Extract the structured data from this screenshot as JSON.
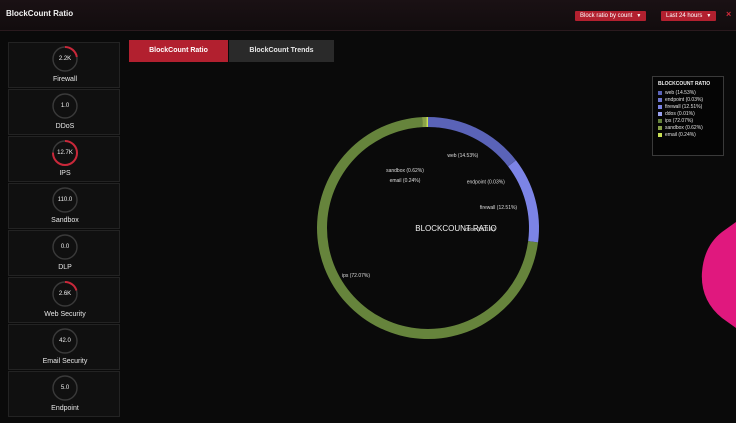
{
  "header": {
    "title": "BlockCount Ratio",
    "dropdown_ratio": "Block ratio by count",
    "dropdown_time": "Last 24 hours",
    "close_symbol": "×"
  },
  "sidebar": {
    "tiles": [
      {
        "value": "2.2K",
        "label": "Firewall",
        "gauge": 0.22
      },
      {
        "value": "1.0",
        "label": "DDoS",
        "gauge": 0.0
      },
      {
        "value": "12.7K",
        "label": "IPS",
        "gauge": 0.75
      },
      {
        "value": "110.0",
        "label": "Sandbox",
        "gauge": 0.0
      },
      {
        "value": "0.0",
        "label": "DLP",
        "gauge": 0.0
      },
      {
        "value": "2.6K",
        "label": "Web Security",
        "gauge": 0.2
      },
      {
        "value": "42.0",
        "label": "Email Security",
        "gauge": 0.0
      },
      {
        "value": "5.0",
        "label": "Endpoint",
        "gauge": 0.0
      }
    ]
  },
  "tabs": [
    {
      "label": "BlockCount Ratio",
      "active": true
    },
    {
      "label": "BlockCount Trends",
      "active": false
    }
  ],
  "legend": {
    "title": "BLOCKCOUNT RATIO",
    "items": [
      {
        "label": "web (14.53%)",
        "color": "#5a63b8"
      },
      {
        "label": "endpoint (0.03%)",
        "color": "#6f77cf"
      },
      {
        "label": "firewall (12.51%)",
        "color": "#7c84e6"
      },
      {
        "label": "ddos (0.01%)",
        "color": "#9aa2f0"
      },
      {
        "label": "ips (72.07%)",
        "color": "#66843c"
      },
      {
        "label": "sandbox (0.62%)",
        "color": "#8aa34a"
      },
      {
        "label": "email (0.24%)",
        "color": "#c8df55"
      }
    ]
  },
  "chart_data": {
    "type": "pie",
    "title": "BLOCKCOUNT RATIO",
    "categories": [
      "web",
      "endpoint",
      "firewall",
      "ddos",
      "ips",
      "sandbox",
      "email"
    ],
    "values": [
      14.53,
      0.03,
      12.51,
      0.01,
      72.07,
      0.62,
      0.24
    ],
    "labels": [
      "web (14.53%)",
      "endpoint (0.03%)",
      "firewall (12.51%)",
      "ddos (0.01%)",
      "ips (72.07%)",
      "sandbox (0.62%)",
      "email (0.24%)"
    ],
    "colors": [
      "#5a63b8",
      "#6f77cf",
      "#7c84e6",
      "#9aa2f0",
      "#66843c",
      "#8aa34a",
      "#c8df55"
    ],
    "legend_position": "top-right"
  }
}
